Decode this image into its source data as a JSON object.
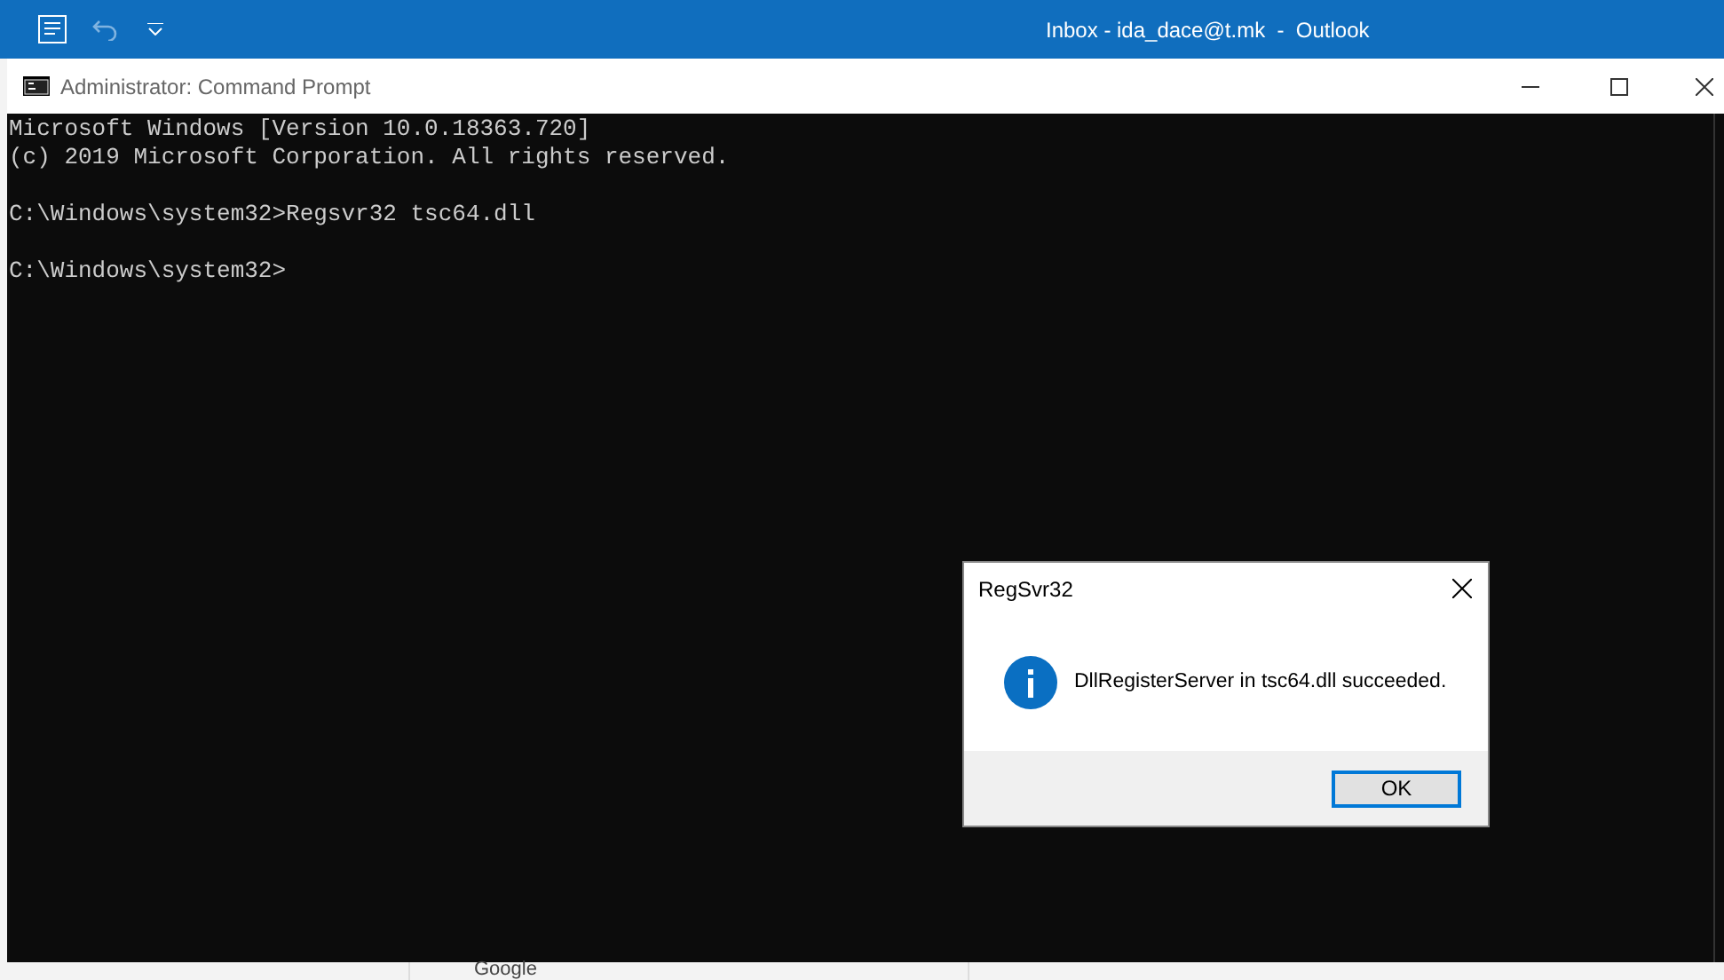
{
  "outlook": {
    "title": "Inbox - ida_dace@t.mk  -  Outlook"
  },
  "window": {
    "title": "Administrator: Command Prompt"
  },
  "console": {
    "paragraphs": [
      [
        "Microsoft Windows [Version 10.0.18363.720]",
        "(c) 2019 Microsoft Corporation. All rights reserved."
      ],
      [
        "C:\\Windows\\system32>Regsvr32 tsc64.dll"
      ],
      [
        "C:\\Windows\\system32>"
      ]
    ]
  },
  "dialog": {
    "title": "RegSvr32",
    "message": "DllRegisterServer in tsc64.dll succeeded.",
    "button": "OK"
  },
  "background": {
    "text": "Google"
  }
}
